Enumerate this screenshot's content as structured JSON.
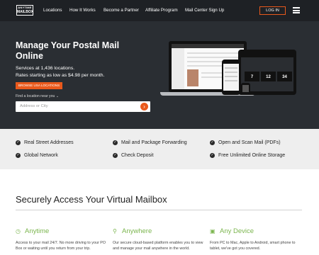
{
  "nav": {
    "logo_line1": "ANYTIME",
    "logo_line2": "MAILBOX",
    "links": [
      "Locations",
      "How It Works",
      "Become a Partner",
      "Affiliate Program",
      "Mail Center Sign Up"
    ],
    "login_label": "LOG IN",
    "menu_icon": "hamburger-icon"
  },
  "hero": {
    "title": "Manage Your Postal Mail Online",
    "subtitle_line1": "Services at 1,436 locations.",
    "subtitle_line2": "Rates starting as low as $4.98 per month.",
    "browse_label": "BROWSE USA LOCATIONS",
    "find_label": "Find a location near you",
    "search_placeholder": "Address or City",
    "search_icon": "arrow-right-icon",
    "tablet_tiles": [
      "7",
      "12",
      "34"
    ]
  },
  "features": [
    "Real Street Addresses",
    "Mail and Package Forwarding",
    "Open and Scan Mail (PDFs)",
    "Global Network",
    "Check Deposit",
    "Free Unlimited Online Storage"
  ],
  "secure": {
    "title": "Securely Access Your Virtual Mailbox",
    "columns": [
      {
        "icon": "clock-icon",
        "heading": "Anytime",
        "text": "Access to your mail 24/7. No more driving to your PO Box or waiting until you return from your trip."
      },
      {
        "icon": "globe-icon",
        "heading": "Anywhere",
        "text": "Our secure cloud-based platform enables you to view and manage your mail anywhere in the world."
      },
      {
        "icon": "devices-icon",
        "heading": "Any Device",
        "text": "From PC to Mac, Apple to Android, smart phone to tablet, we've got you covered."
      }
    ]
  },
  "colors": {
    "accent": "#e9591c",
    "nav_bg": "#1e2125",
    "hero_bg": "#2a2e33",
    "feature_bg": "#eeeeee",
    "green": "#7bb54e"
  }
}
